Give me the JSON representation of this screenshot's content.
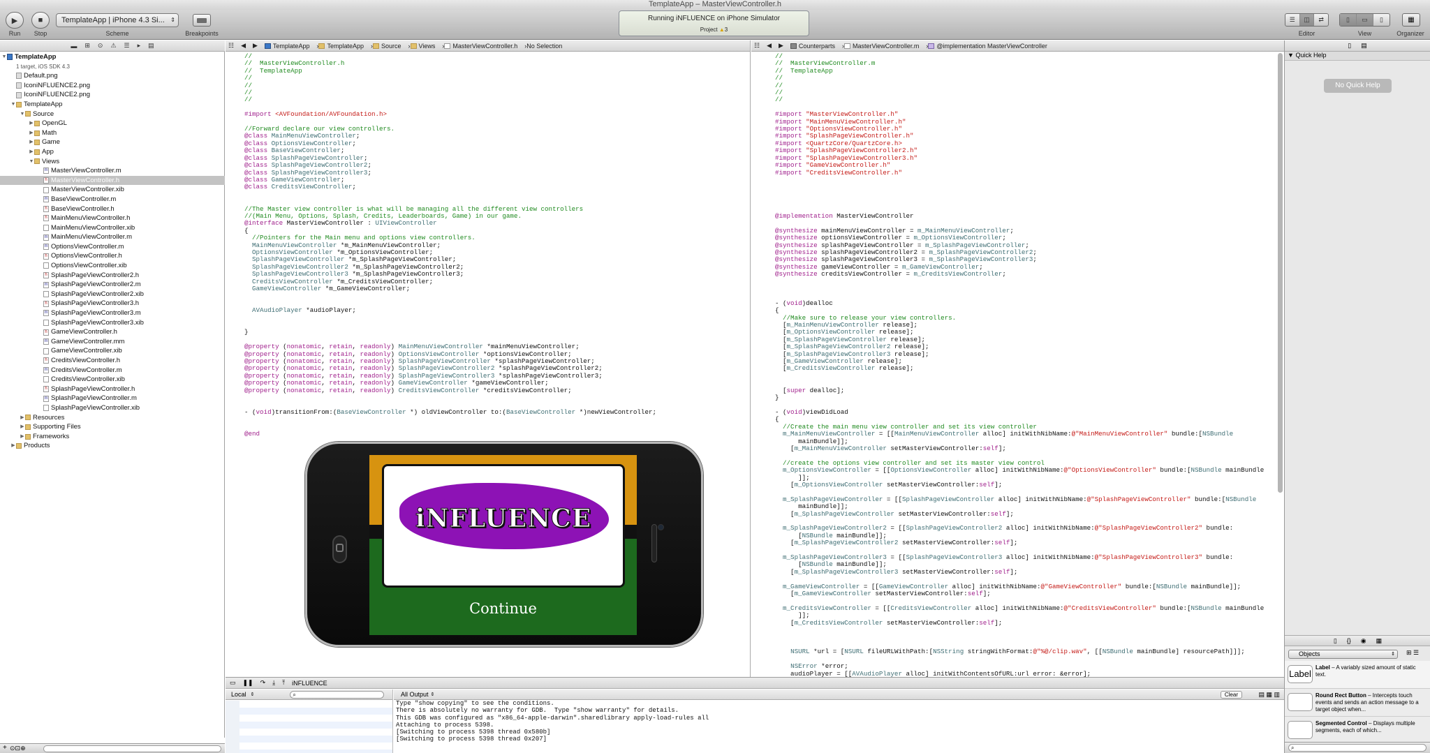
{
  "window": {
    "title": "TemplateApp – MasterViewController.h"
  },
  "toolbar": {
    "run_label": "Run",
    "stop_label": "Stop",
    "scheme_value": "TemplateApp | iPhone 4.3 Si...",
    "scheme_label": "Scheme",
    "breakpoints_label": "Breakpoints",
    "activity_line1": "Running iNFLUENCE on iPhone Simulator",
    "activity_project": "Project",
    "activity_warnings": "3",
    "editor_label": "Editor",
    "view_label": "View",
    "organizer_label": "Organizer"
  },
  "navigator": {
    "items": [
      {
        "label": "TemplateApp",
        "depth": 0,
        "type": "project",
        "tri": "▼",
        "bold": true
      },
      {
        "label": "1 target, iOS SDK 4.3",
        "depth": 1,
        "type": "sub",
        "tri": ""
      },
      {
        "label": "Default.png",
        "depth": 1,
        "type": "p",
        "tri": ""
      },
      {
        "label": "IconiNFLUENCE2.png",
        "depth": 1,
        "type": "p",
        "tri": ""
      },
      {
        "label": "IconiNFLUENCE2.png",
        "depth": 1,
        "type": "p",
        "tri": ""
      },
      {
        "label": "TemplateApp",
        "depth": 1,
        "type": "g",
        "tri": "▼"
      },
      {
        "label": "Source",
        "depth": 2,
        "type": "g",
        "tri": "▼"
      },
      {
        "label": "OpenGL",
        "depth": 3,
        "type": "g",
        "tri": "▶"
      },
      {
        "label": "Math",
        "depth": 3,
        "type": "g",
        "tri": "▶"
      },
      {
        "label": "Game",
        "depth": 3,
        "type": "g",
        "tri": "▶"
      },
      {
        "label": "App",
        "depth": 3,
        "type": "g",
        "tri": "▶"
      },
      {
        "label": "Views",
        "depth": 3,
        "type": "g",
        "tri": "▼"
      },
      {
        "label": "MasterViewController.m",
        "depth": 4,
        "type": "m",
        "tri": ""
      },
      {
        "label": "MasterViewController.h",
        "depth": 4,
        "type": "h",
        "tri": "",
        "selected": true
      },
      {
        "label": "MasterViewController.xib",
        "depth": 4,
        "type": "x",
        "tri": ""
      },
      {
        "label": "BaseViewController.m",
        "depth": 4,
        "type": "m",
        "tri": ""
      },
      {
        "label": "BaseViewController.h",
        "depth": 4,
        "type": "h",
        "tri": ""
      },
      {
        "label": "MainMenuViewController.h",
        "depth": 4,
        "type": "h",
        "tri": ""
      },
      {
        "label": "MainMenuViewController.xib",
        "depth": 4,
        "type": "x",
        "tri": ""
      },
      {
        "label": "MainMenuViewController.m",
        "depth": 4,
        "type": "m",
        "tri": ""
      },
      {
        "label": "OptionsViewController.m",
        "depth": 4,
        "type": "m",
        "tri": ""
      },
      {
        "label": "OptionsViewController.h",
        "depth": 4,
        "type": "h",
        "tri": ""
      },
      {
        "label": "OptionsViewController.xib",
        "depth": 4,
        "type": "x",
        "tri": ""
      },
      {
        "label": "SplashPageViewController2.h",
        "depth": 4,
        "type": "h",
        "tri": ""
      },
      {
        "label": "SplashPageViewController2.m",
        "depth": 4,
        "type": "m",
        "tri": ""
      },
      {
        "label": "SplashPageViewController2.xib",
        "depth": 4,
        "type": "x",
        "tri": ""
      },
      {
        "label": "SplashPageViewController3.h",
        "depth": 4,
        "type": "h",
        "tri": ""
      },
      {
        "label": "SplashPageViewController3.m",
        "depth": 4,
        "type": "m",
        "tri": ""
      },
      {
        "label": "SplashPageViewController3.xib",
        "depth": 4,
        "type": "x",
        "tri": ""
      },
      {
        "label": "GameViewController.h",
        "depth": 4,
        "type": "h",
        "tri": ""
      },
      {
        "label": "GameViewController.mm",
        "depth": 4,
        "type": "m",
        "tri": ""
      },
      {
        "label": "GameViewController.xib",
        "depth": 4,
        "type": "x",
        "tri": ""
      },
      {
        "label": "CreditsViewController.h",
        "depth": 4,
        "type": "h",
        "tri": ""
      },
      {
        "label": "CreditsViewController.m",
        "depth": 4,
        "type": "m",
        "tri": ""
      },
      {
        "label": "CreditsViewController.xib",
        "depth": 4,
        "type": "x",
        "tri": ""
      },
      {
        "label": "SplashPageViewController.h",
        "depth": 4,
        "type": "h",
        "tri": ""
      },
      {
        "label": "SplashPageViewController.m",
        "depth": 4,
        "type": "m",
        "tri": ""
      },
      {
        "label": "SplashPageViewController.xib",
        "depth": 4,
        "type": "x",
        "tri": ""
      },
      {
        "label": "Resources",
        "depth": 2,
        "type": "g",
        "tri": "▶"
      },
      {
        "label": "Supporting Files",
        "depth": 2,
        "type": "g",
        "tri": "▶"
      },
      {
        "label": "Frameworks",
        "depth": 2,
        "type": "g",
        "tri": "▶"
      },
      {
        "label": "Products",
        "depth": 1,
        "type": "g",
        "tri": "▶"
      }
    ]
  },
  "left_editor": {
    "jump": [
      "TemplateApp",
      "TemplateApp",
      "Source",
      "Views",
      "MasterViewController.h",
      "No Selection"
    ]
  },
  "right_editor": {
    "jump": [
      "Counterparts",
      "MasterViewController.m",
      "@implementation MasterViewController"
    ]
  },
  "quick_help": {
    "title": "Quick Help",
    "empty": "No Quick Help"
  },
  "library": {
    "selector": "Objects",
    "items": [
      {
        "icon": "Label",
        "title": "Label",
        "desc": "– A variably sized amount of static text."
      },
      {
        "icon": "",
        "title": "Round Rect Button",
        "desc": "– Intercepts touch events and sends an action message to a target object when..."
      },
      {
        "icon": "",
        "title": "Segmented Control",
        "desc": "– Displays multiple segments, each of which..."
      }
    ]
  },
  "debug": {
    "process": "iNFLUENCE",
    "scope": "Local",
    "output_mode": "All Output",
    "clear_label": "Clear",
    "console": [
      "Type \"show copying\" to see the conditions.",
      "There is absolutely no warranty for GDB.  Type \"show warranty\" for details.",
      "This GDB was configured as \"x86_64-apple-darwin\".sharedlibrary apply-load-rules all",
      "Attaching to process 5398.",
      "[Switching to process 5398 thread 0x580b]",
      "[Switching to process 5398 thread 0x207]"
    ]
  },
  "simulator": {
    "game_title": "iNFLUENCE",
    "continue_label": "Continue"
  }
}
